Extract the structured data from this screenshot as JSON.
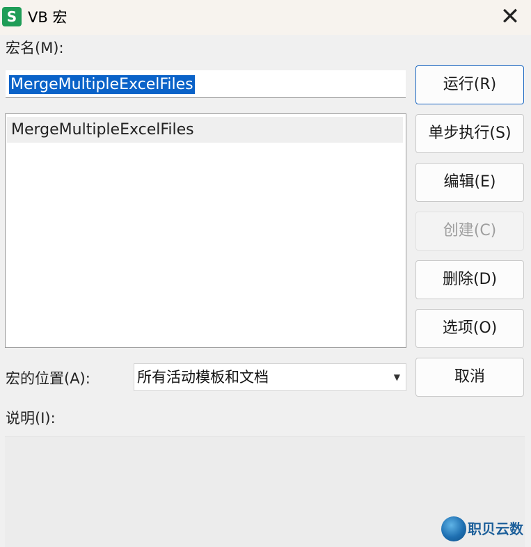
{
  "window": {
    "icon_letter": "S",
    "title": "VB 宏",
    "close": "✕"
  },
  "macro_name": {
    "label": "宏名(M):",
    "value": "MergeMultipleExcelFiles"
  },
  "macro_list": {
    "items": [
      "MergeMultipleExcelFiles"
    ]
  },
  "buttons": {
    "run": "运行(R)",
    "step": "单步执行(S)",
    "edit": "编辑(E)",
    "create": "创建(C)",
    "delete": "删除(D)",
    "options": "选项(O)",
    "cancel": "取消"
  },
  "location": {
    "label": "宏的位置(A):",
    "selected": "所有活动模板和文档",
    "arrow": "▼"
  },
  "description": {
    "label": "说明(I):",
    "text": ""
  },
  "watermark": {
    "text": "职贝云数"
  },
  "colors": {
    "accent": "#1a67c2",
    "selection": "#0a62c8",
    "app_icon": "#1f9d57"
  }
}
